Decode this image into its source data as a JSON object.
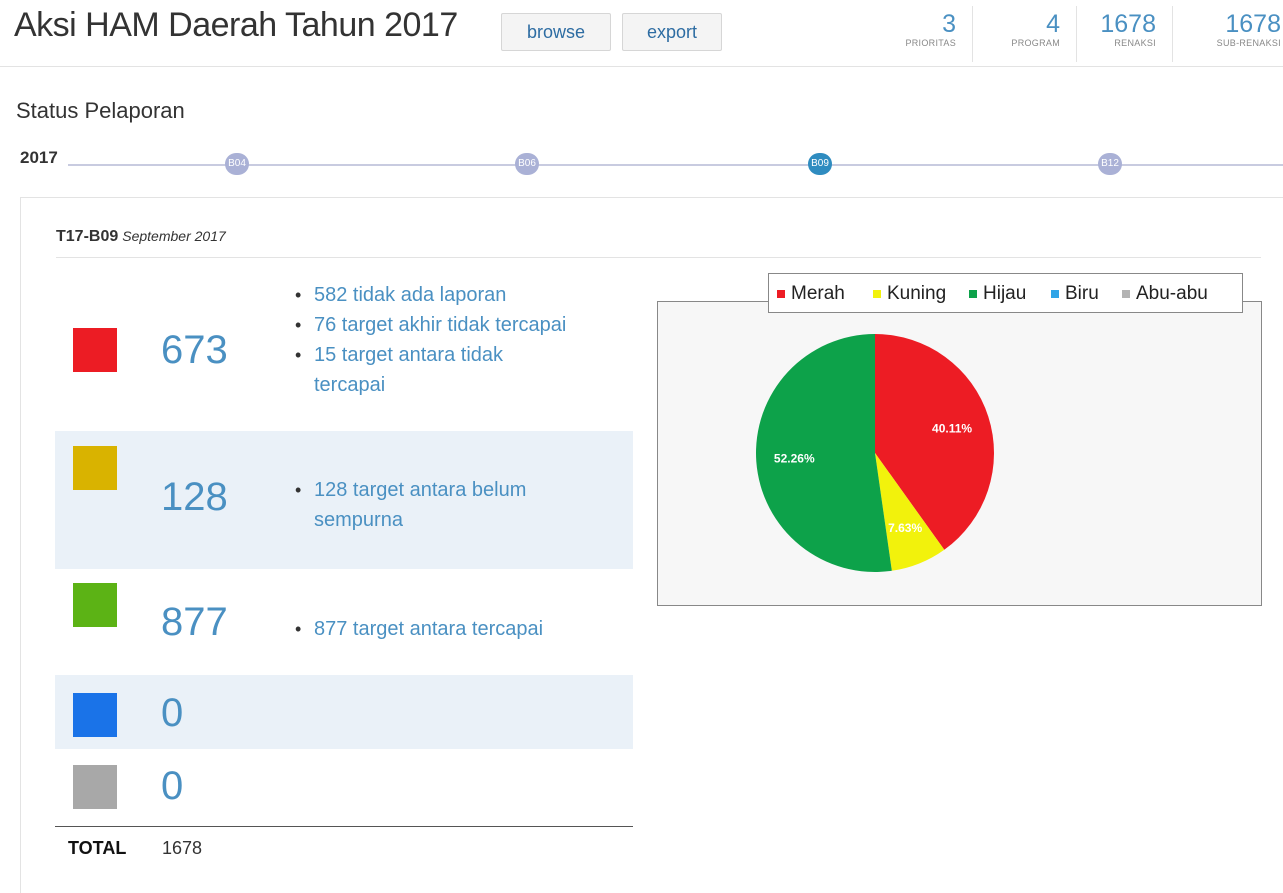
{
  "header": {
    "title": "Aksi HAM Daerah Tahun 2017",
    "browse_label": "browse",
    "export_label": "export",
    "stats": [
      {
        "value": "3",
        "label": "PRIORITAS"
      },
      {
        "value": "4",
        "label": "PROGRAM"
      },
      {
        "value": "1678",
        "label": "RENAKSI"
      },
      {
        "value": "1678",
        "label": "SUB-RENAKSI"
      }
    ]
  },
  "section_title": "Status Pelaporan",
  "timeline": {
    "year": "2017",
    "nodes": [
      "B04",
      "B06",
      "B09",
      "B12"
    ],
    "active": "B09"
  },
  "period": {
    "code": "T17-B09",
    "label": "September 2017"
  },
  "rows": [
    {
      "color": "#ec1c24",
      "count": "673",
      "notes": [
        "582 tidak ada laporan",
        "76 target akhir tidak tercapai",
        "15 target antara tidak tercapai"
      ]
    },
    {
      "color": "#d9b300",
      "count": "128",
      "notes": [
        "128 target antara belum sempurna"
      ]
    },
    {
      "color": "#5cb315",
      "count": "877",
      "notes": [
        "877 target antara tercapai"
      ]
    },
    {
      "color": "#1a73e8",
      "count": "0",
      "notes": []
    },
    {
      "color": "#a8a8a8",
      "count": "0",
      "notes": []
    }
  ],
  "total": {
    "label": "TOTAL",
    "value": "1678"
  },
  "chart_data": {
    "type": "pie",
    "slices": [
      {
        "name": "Merah",
        "value": 40.11,
        "color": "#ed1c24",
        "label": "40.11%"
      },
      {
        "name": "Kuning",
        "value": 7.63,
        "color": "#f2f20c",
        "label": "7.63%"
      },
      {
        "name": "Hijau",
        "value": 52.26,
        "color": "#0da24a",
        "label": "52.26%"
      },
      {
        "name": "Biru",
        "value": 0,
        "color": "#2fa4e7",
        "label": ""
      },
      {
        "name": "Abu-abu",
        "value": 0,
        "color": "#b3b3b3",
        "label": ""
      }
    ],
    "legend_position": "top"
  }
}
